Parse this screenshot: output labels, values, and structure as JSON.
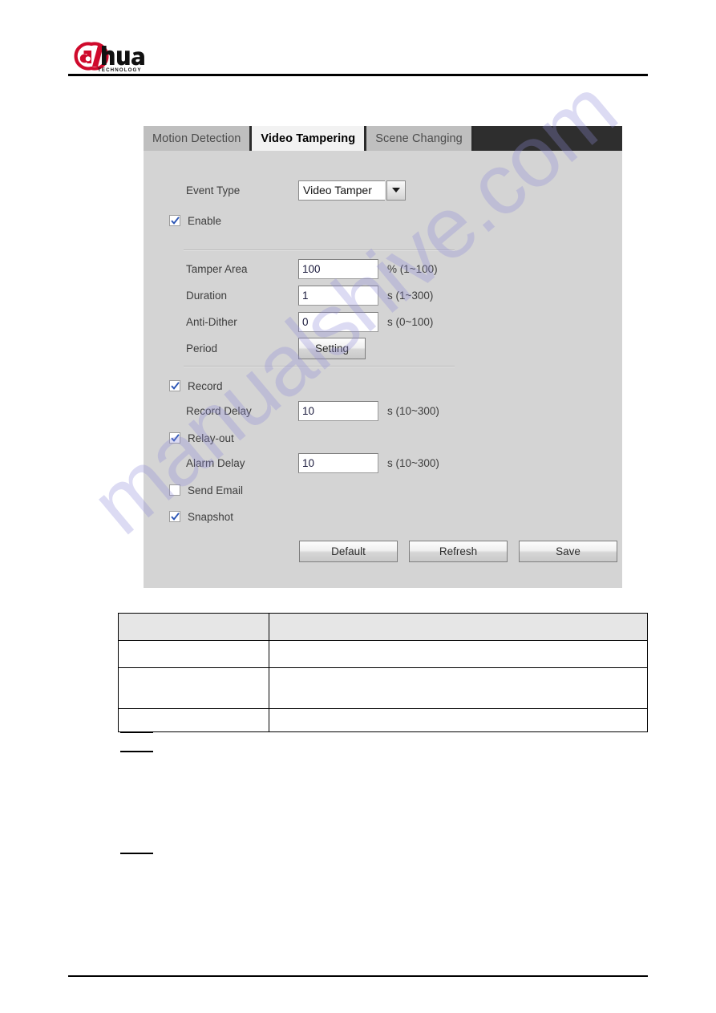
{
  "document": {
    "brand": "alhua",
    "brand_sub": "TECHNOLOGY"
  },
  "panel": {
    "tabs": [
      {
        "label": "Motion Detection",
        "active": false
      },
      {
        "label": "Video Tampering",
        "active": true
      },
      {
        "label": "Scene Changing",
        "active": false
      }
    ],
    "event_type": {
      "label": "Event Type",
      "value": "Video Tamper",
      "caret_icon": "chevron-down-icon"
    },
    "enable": {
      "label": "Enable",
      "checked": true
    },
    "fields": [
      {
        "label": "Tamper Area",
        "value": "100",
        "hint": "% (1~100)"
      },
      {
        "label": "Duration",
        "value": "1",
        "hint": "s (1~300)"
      },
      {
        "label": "Anti-Dither",
        "value": "0",
        "hint": "s (0~100)"
      }
    ],
    "period": {
      "label": "Period",
      "button": "Setting"
    },
    "record": {
      "label": "Record",
      "checked": true
    },
    "record_delay": {
      "label": "Record Delay",
      "value": "10",
      "hint": "s (10~300)"
    },
    "relay_out": {
      "label": "Relay-out",
      "checked": true
    },
    "alarm_delay": {
      "label": "Alarm Delay",
      "value": "10",
      "hint": "s (10~300)"
    },
    "send_email": {
      "label": "Send Email",
      "checked": false
    },
    "snapshot": {
      "label": "Snapshot",
      "checked": true
    },
    "actions": {
      "default_label": "Default",
      "refresh_label": "Refresh",
      "save_label": "Save"
    }
  },
  "table": {
    "header": [
      "",
      ""
    ],
    "rows": [
      [
        "",
        ""
      ],
      [
        "",
        ""
      ],
      [
        "",
        ""
      ]
    ]
  },
  "watermark": {
    "text": "manualshive.com",
    "color": "#8f8ad8"
  }
}
